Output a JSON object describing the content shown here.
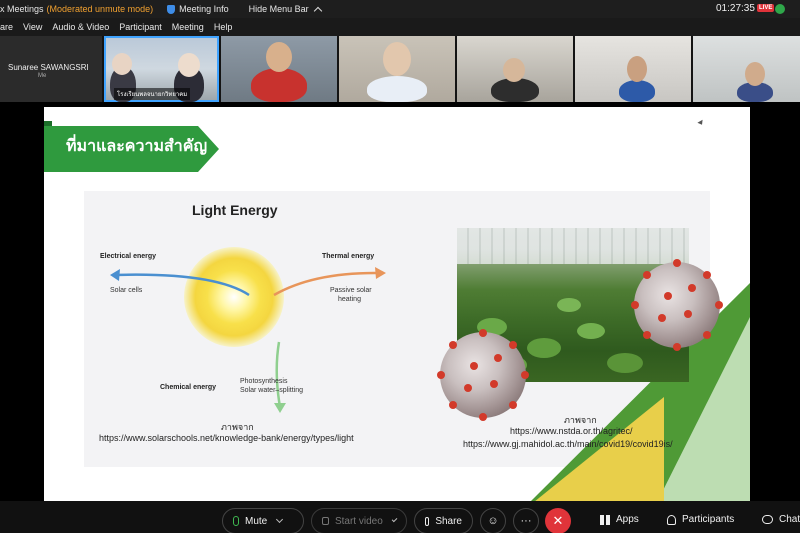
{
  "app": {
    "title": "x Meetings",
    "mode": "(Moderated unmute mode)",
    "meeting_info": "Meeting Info",
    "hide_menu_bar": "Hide Menu Bar",
    "clock": "01:27:35",
    "live_badge": "LIVE"
  },
  "menu": [
    "are",
    "View",
    "Audio & Video",
    "Participant",
    "Meeting",
    "Help"
  ],
  "self_view": {
    "name": "Sunaree SAWANGSRI",
    "sub": "Me"
  },
  "participants": [
    {
      "label": "โรงเรียนพลจนายกวิทยาคม"
    },
    {
      "label": ""
    },
    {
      "label": ""
    },
    {
      "label": ""
    },
    {
      "label": ""
    },
    {
      "label": ""
    }
  ],
  "slide": {
    "title": "ที่มาและความสำคัญ",
    "diagram": {
      "title": "Light Energy",
      "electrical": "Electrical energy",
      "solar_cells": "Solar cells",
      "thermal": "Thermal energy",
      "passive_1": "Passive solar",
      "passive_2": "heating",
      "chemical": "Chemical energy",
      "photo_1": "Photosynthesis",
      "photo_2": "Solar water–splitting"
    },
    "credit_left": {
      "heading": "ภาพจาก",
      "url": "https://www.solarschools.net/knowledge-bank/energy/types/light"
    },
    "credit_right": {
      "heading": "ภาพจาก",
      "url1": "https://www.nstda.or.th/agritec/",
      "url2": "https://www.gj.mahidol.ac.th/main/covid19/covid19is/"
    },
    "colors": {
      "banner": "#2f9a3e",
      "arrow_left": "#4a8fd0",
      "arrow_right": "#e8955a",
      "arrow_down": "#8fcf8f"
    }
  },
  "controls": {
    "mute": "Mute",
    "start_video": "Start video",
    "share": "Share",
    "reactions_icon": "smile-icon",
    "more": "···",
    "end_icon": "close-icon",
    "apps": "Apps",
    "participants": "Participants",
    "chat": "Chat"
  }
}
